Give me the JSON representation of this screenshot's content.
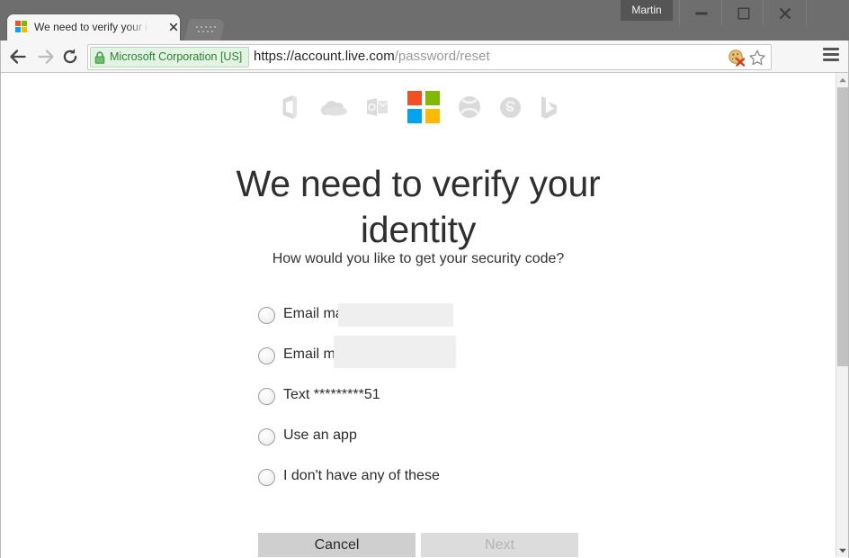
{
  "browser": {
    "tab": {
      "title": "We need to verify your ide",
      "favicon": "microsoft-logo-favicon",
      "close": "×",
      "new_tab": "new-tab-button"
    },
    "profile": {
      "name": "Martin"
    },
    "window_controls": {
      "minimize": "minimize",
      "maximize": "maximize",
      "close": "close"
    },
    "nav": {
      "back": "back",
      "forward": "forward",
      "reload": "reload"
    },
    "omnibox": {
      "ev_certificate": "Microsoft Corporation [US]",
      "lock": "lock-icon",
      "url_host": "https://account.live.com",
      "url_path": "/password/reset"
    },
    "toolbar_icons": {
      "cookie": "cookies-blocked-icon",
      "bookmark": "bookmark-star-icon",
      "menu": "chrome-menu-icon"
    },
    "scrollbar": {
      "up": "scroll-up",
      "down": "scroll-down"
    }
  },
  "page": {
    "brand_icons": [
      {
        "name": "office-icon",
        "color": "#d9d9d9"
      },
      {
        "name": "onedrive-icon",
        "color": "#d9d9d9"
      },
      {
        "name": "outlook-icon",
        "color": "#d9d9d9"
      },
      {
        "name": "microsoft-logo-icon",
        "color": "multi"
      },
      {
        "name": "xbox-icon",
        "color": "#d9d9d9"
      },
      {
        "name": "skype-icon",
        "color": "#d9d9d9"
      },
      {
        "name": "bing-icon",
        "color": "#d9d9d9"
      }
    ],
    "heading": "We need to verify your identity",
    "prompt": "How would you like to get your security code?",
    "options": [
      {
        "label": "Email ma",
        "redacted": true
      },
      {
        "label": "Email ma",
        "redacted": true
      },
      {
        "label": "Text *********51",
        "redacted": false
      },
      {
        "label": "Use an app",
        "redacted": false
      },
      {
        "label": "I don't have any of these",
        "redacted": false
      }
    ],
    "buttons": {
      "cancel": "Cancel",
      "next": "Next"
    },
    "colors": {
      "ms_red": "#f25022",
      "ms_green": "#7fba00",
      "ms_blue": "#00a4ef",
      "ms_yellow": "#ffb900",
      "ev_green": "#2e7d32",
      "heading": "#2f2f2f"
    }
  }
}
